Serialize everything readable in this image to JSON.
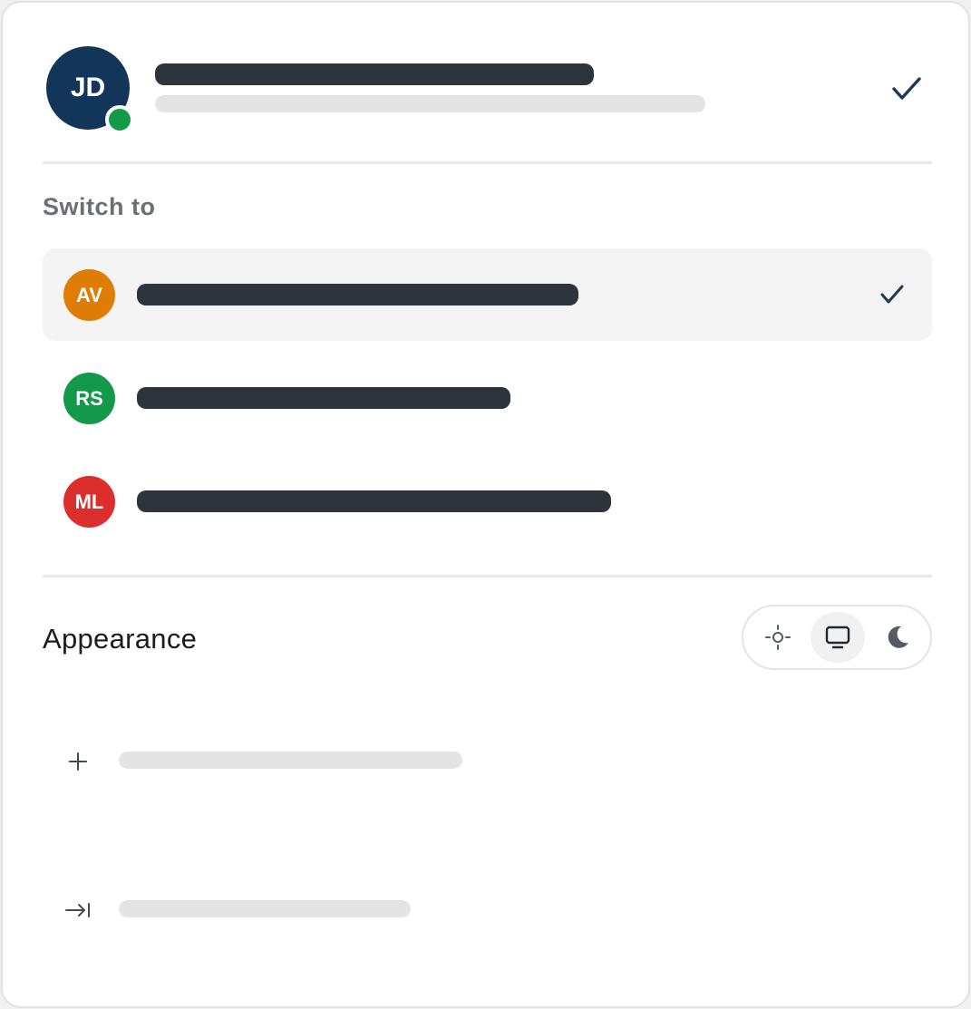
{
  "current_account": {
    "initials": "JD",
    "avatar_color": "#12365a",
    "status_color": "#129a48",
    "status": "online",
    "selected": true
  },
  "switch_section": {
    "heading": "Switch to",
    "accounts": [
      {
        "initials": "AV",
        "avatar_color": "#de7c04",
        "selected": true
      },
      {
        "initials": "RS",
        "avatar_color": "#14994a",
        "selected": false
      },
      {
        "initials": "ML",
        "avatar_color": "#dd2e2e",
        "selected": false
      }
    ]
  },
  "appearance": {
    "label": "Appearance",
    "options": [
      "light-icon",
      "system-icon",
      "dark-icon"
    ],
    "selected": "system"
  },
  "actions": [
    {
      "icon": "plus-icon"
    },
    {
      "icon": "sign-out-icon"
    }
  ]
}
